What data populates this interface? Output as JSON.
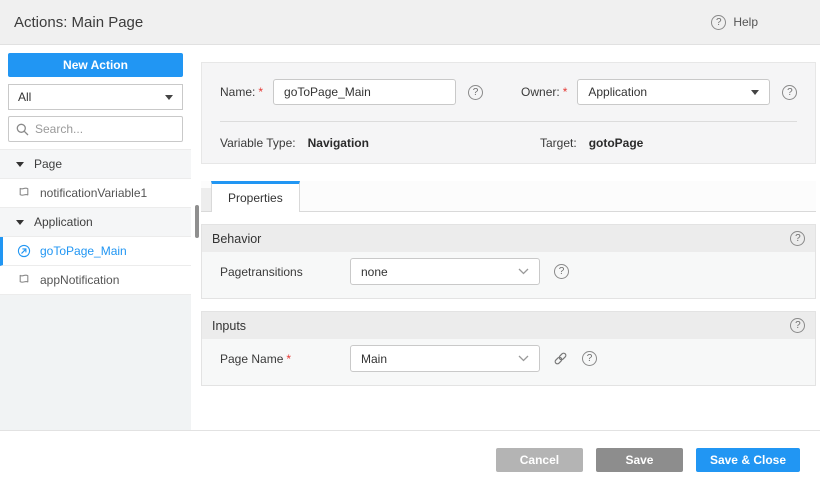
{
  "header": {
    "title": "Actions: Main Page",
    "help_label": "Help"
  },
  "icons": {
    "help_glyph": "?",
    "required_marker": "*"
  },
  "sidebar": {
    "new_action_label": "New Action",
    "filter_value": "All",
    "search_placeholder": "Search...",
    "tree": [
      {
        "type": "group",
        "label": "Page"
      },
      {
        "type": "item",
        "label": "notificationVariable1",
        "icon": "variable-flag-icon",
        "selected": false
      },
      {
        "type": "group",
        "label": "Application"
      },
      {
        "type": "item",
        "label": "goToPage_Main",
        "icon": "navigation-icon",
        "selected": true
      },
      {
        "type": "item",
        "label": "appNotification",
        "icon": "variable-flag-icon",
        "selected": false
      }
    ]
  },
  "form": {
    "name_label": "Name:",
    "name_value": "goToPage_Main",
    "owner_label": "Owner:",
    "owner_value": "Application",
    "variable_type_label": "Variable Type:",
    "variable_type_value": "Navigation",
    "target_label": "Target:",
    "target_value": "gotoPage"
  },
  "tabs": [
    {
      "label": "Properties",
      "active": true
    }
  ],
  "sections": {
    "behavior": {
      "title": "Behavior",
      "fields": [
        {
          "label": "Pagetransitions",
          "value": "none",
          "required": false
        }
      ]
    },
    "inputs": {
      "title": "Inputs",
      "fields": [
        {
          "label": "Page Name",
          "value": "Main",
          "required": true
        }
      ]
    }
  },
  "footer": {
    "cancel_label": "Cancel",
    "save_label": "Save",
    "save_close_label": "Save & Close"
  },
  "colors": {
    "accent_blue": "#2196F3",
    "selected_item_text": "#2196F3",
    "cancel_gray": "#b4b4b4",
    "save_gray": "#8d8d8d",
    "required_red": "#e53935",
    "topbar_bg": "#f0f0f0",
    "panel_bg": "#f5f5f6",
    "section_header_bg": "#ececec"
  }
}
